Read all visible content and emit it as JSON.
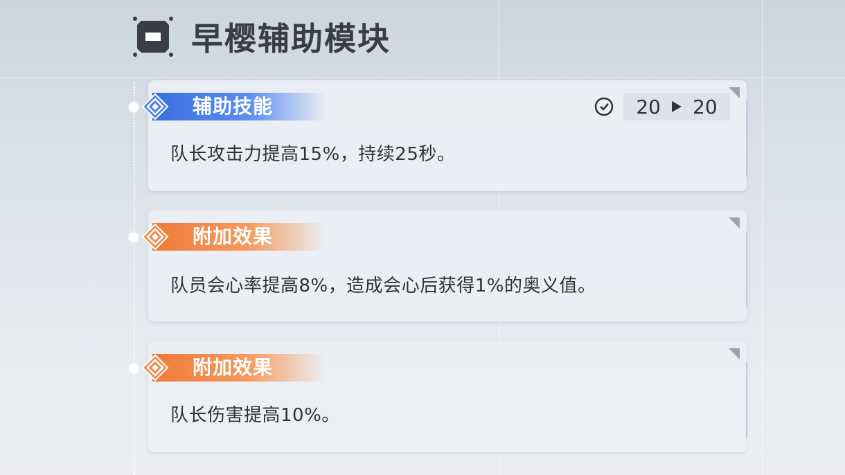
{
  "header": {
    "title": "早樱辅助模块",
    "icon": "module-chip-icon"
  },
  "cards": [
    {
      "tag": "辅助技能",
      "tag_color": "#4a7fe8",
      "icon": "diamond-icon",
      "text": "队长攻击力提高15%，持续25秒。",
      "cooldown": {
        "icon": "timer-icon",
        "from": "20",
        "to": "20"
      }
    },
    {
      "tag": "附加效果",
      "tag_color": "#f28a4a",
      "icon": "diamond-icon",
      "text": "队员会心率提高8%，造成会心后获得1%的奥义值。"
    },
    {
      "tag": "附加效果",
      "tag_color": "#f28a4a",
      "icon": "diamond-icon",
      "text": "队长伤害提高10%。"
    }
  ]
}
